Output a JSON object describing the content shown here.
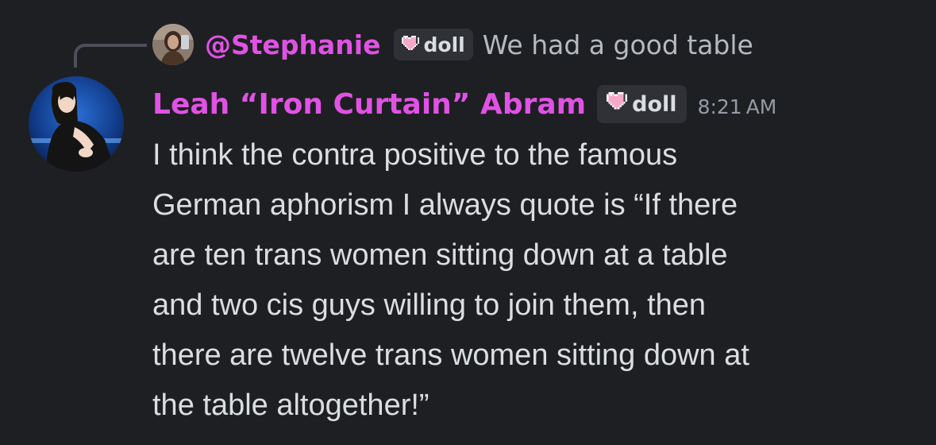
{
  "reply": {
    "author": "@Stephanie",
    "badge_label": "doll",
    "text": "We had a good table"
  },
  "message": {
    "author": "Leah “Iron Curtain” Abram",
    "badge_label": "doll",
    "timestamp": "8:21 AM",
    "lines": [
      "I think the contra positive to the famous",
      "German aphorism I  always quote is “If there",
      "are ten trans women sitting down at a table",
      "and two cis guys willing to join them, then",
      "there are twelve trans women sitting down at",
      "the table altogether!”"
    ]
  },
  "icons": {
    "badge_icon": "pixel-heart-icon",
    "reply_avatar": "user-avatar",
    "author_avatar": "user-avatar"
  },
  "colors": {
    "background": "#1e1f22",
    "author_name": "#e052e4",
    "badge_bg": "#2f3136",
    "text": "#dbdee1",
    "muted": "#b5bac1",
    "timestamp": "#949ba4",
    "heart": "#f7a8c8"
  }
}
